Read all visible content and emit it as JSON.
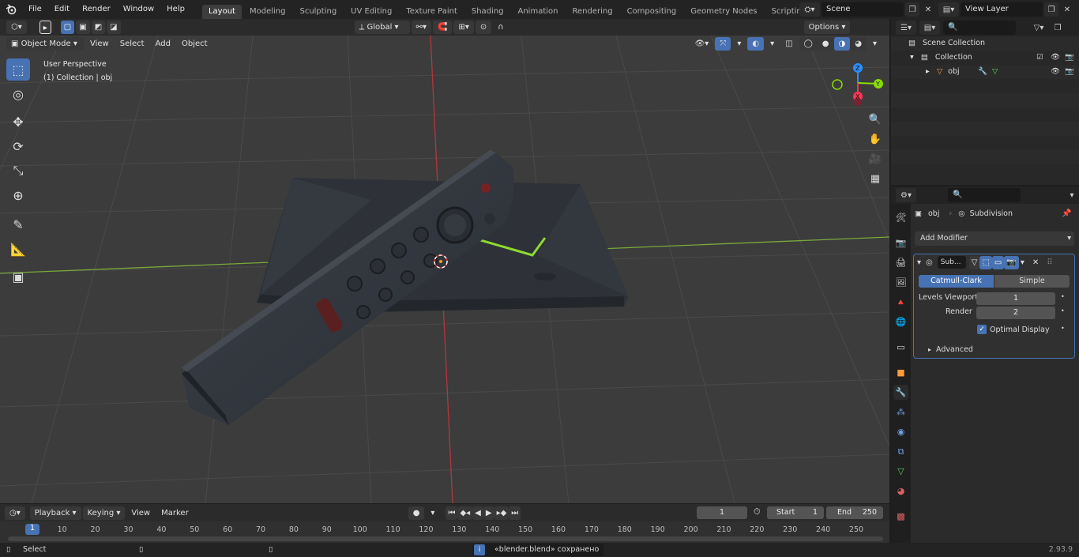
{
  "menu": [
    "File",
    "Edit",
    "Render",
    "Window",
    "Help"
  ],
  "workspaces": [
    "Layout",
    "Modeling",
    "Sculpting",
    "UV Editing",
    "Texture Paint",
    "Shading",
    "Animation",
    "Rendering",
    "Compositing",
    "Geometry Nodes",
    "Scripting"
  ],
  "active_workspace": "Layout",
  "scene": {
    "name": "Scene"
  },
  "view_layer": {
    "name": "View Layer"
  },
  "viewport_header": {
    "orientation": "Global",
    "options": "Options",
    "mode": "Object Mode",
    "menus": [
      "View",
      "Select",
      "Add",
      "Object"
    ]
  },
  "viewport": {
    "perspective_label": "User Perspective",
    "collection_label": "(1) Collection | obj",
    "axes": {
      "x": "X",
      "y": "Y",
      "z": "Z"
    }
  },
  "outliner": {
    "search_placeholder": "",
    "scene_collection": "Scene Collection",
    "collection": "Collection",
    "object": "obj"
  },
  "properties": {
    "object_name": "obj",
    "modifier_name": "Subdivision",
    "add_modifier": "Add Modifier",
    "modifier_short": "Sub...",
    "catmull_clark": "Catmull-Clark",
    "simple": "Simple",
    "levels_viewport_label": "Levels Viewport",
    "levels_viewport_value": "1",
    "render_label": "Render",
    "render_value": "2",
    "optimal_display": "Optimal Display",
    "advanced": "Advanced"
  },
  "timeline": {
    "menus": [
      "Playback",
      "Keying",
      "View",
      "Marker"
    ],
    "current_frame": "1",
    "start_label": "Start",
    "start_value": "1",
    "end_label": "End",
    "end_value": "250",
    "ruler": [
      "1",
      "10",
      "20",
      "30",
      "40",
      "50",
      "60",
      "70",
      "80",
      "90",
      "100",
      "110",
      "120",
      "130",
      "140",
      "150",
      "160",
      "170",
      "180",
      "190",
      "200",
      "210",
      "220",
      "230",
      "240",
      "250"
    ]
  },
  "status": {
    "select": "Select",
    "message": "«blender.blend» сохранено",
    "version": "2.93.9"
  },
  "colors": {
    "accent": "#4772b3",
    "x_axis": "#ff3352",
    "y_axis": "#8bdc00",
    "z_axis": "#2890ff"
  }
}
